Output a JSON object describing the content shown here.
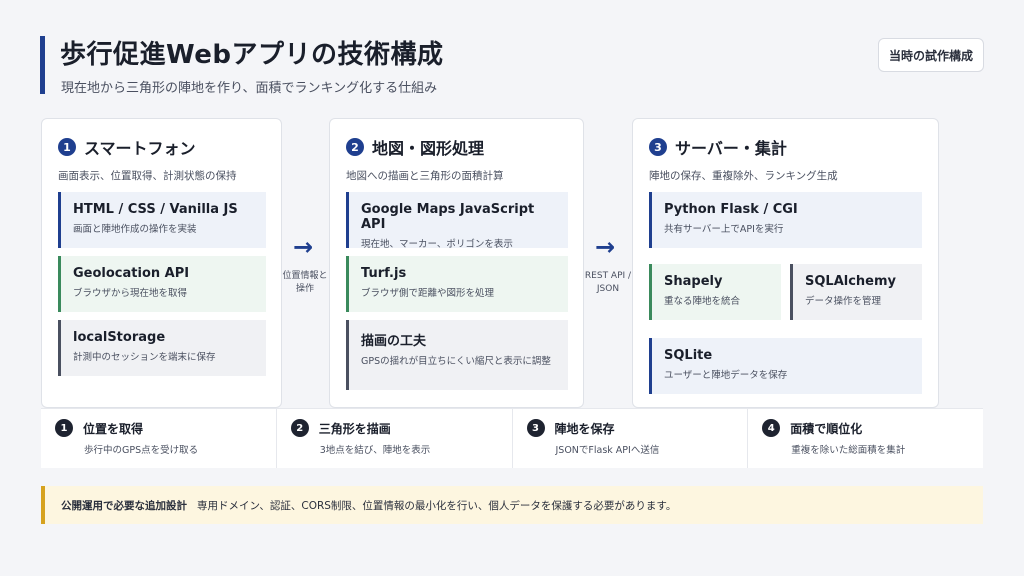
{
  "header": {
    "title": "歩行促進Webアプリの技術構成",
    "subtitle": "現在地から三角形の陣地を作り、面積でランキング化する仕組み",
    "prototype_label": "当時の試作構成"
  },
  "cards": [
    {
      "num": "1",
      "title": "スマートフォン",
      "desc": "画面表示、位置取得、計測状態の保持",
      "boxes": [
        {
          "title": "HTML / CSS / Vanilla JS",
          "desc": "画面と陣地作成の操作を実装",
          "style": "blue"
        },
        {
          "title": "Geolocation API",
          "desc": "ブラウザから現在地を取得",
          "style": "green"
        },
        {
          "title": "localStorage",
          "desc": "計測中のセッションを端末に保存",
          "style": "gray"
        }
      ]
    },
    {
      "num": "2",
      "title": "地図・図形処理",
      "desc": "地図への描画と三角形の面積計算",
      "boxes": [
        {
          "title": "Google Maps JavaScript API",
          "desc": "現在地、マーカー、ポリゴンを表示",
          "style": "blue"
        },
        {
          "title": "Turf.js",
          "desc": "ブラウザ側で距離や図形を処理",
          "style": "green"
        },
        {
          "title": "描画の工夫",
          "desc": "GPSの揺れが目立ちにくい縮尺と表示に調整",
          "style": "gray"
        }
      ]
    },
    {
      "num": "3",
      "title": "サーバー・集計",
      "desc": "陣地の保存、重複除外、ランキング生成",
      "boxes": [
        {
          "title": "Python Flask / CGI",
          "desc": "共有サーバー上でAPIを実行",
          "style": "blue"
        },
        {
          "title": "Shapely",
          "desc": "重なる陣地を統合",
          "style": "green"
        },
        {
          "title": "SQLAlchemy",
          "desc": "データ操作を管理",
          "style": "gray"
        },
        {
          "title": "SQLite",
          "desc": "ユーザーと陣地データを保存",
          "style": "blue"
        }
      ]
    }
  ],
  "arrows": [
    {
      "label_line1": "位置情報と",
      "label_line2": "操作"
    },
    {
      "label_line1": "REST API /",
      "label_line2": "JSON"
    }
  ],
  "arrow_glyph": "→",
  "steps": [
    {
      "num": "1",
      "title": "位置を取得",
      "desc": "歩行中のGPS点を受け取る"
    },
    {
      "num": "2",
      "title": "三角形を描画",
      "desc": "3地点を結び、陣地を表示"
    },
    {
      "num": "3",
      "title": "陣地を保存",
      "desc": "JSONでFlask APIへ送信"
    },
    {
      "num": "4",
      "title": "面積で順位化",
      "desc": "重複を除いた総面積を集計"
    }
  ],
  "note": {
    "label": "公開運用で必要な追加設計",
    "text": "専用ドメイン、認証、CORS制限、位置情報の最小化を行い、個人データを保護する必要があります。"
  },
  "colors": {
    "accent": "#1f3f8f",
    "green": "#3a8a5c",
    "warn": "#d6a21e"
  }
}
